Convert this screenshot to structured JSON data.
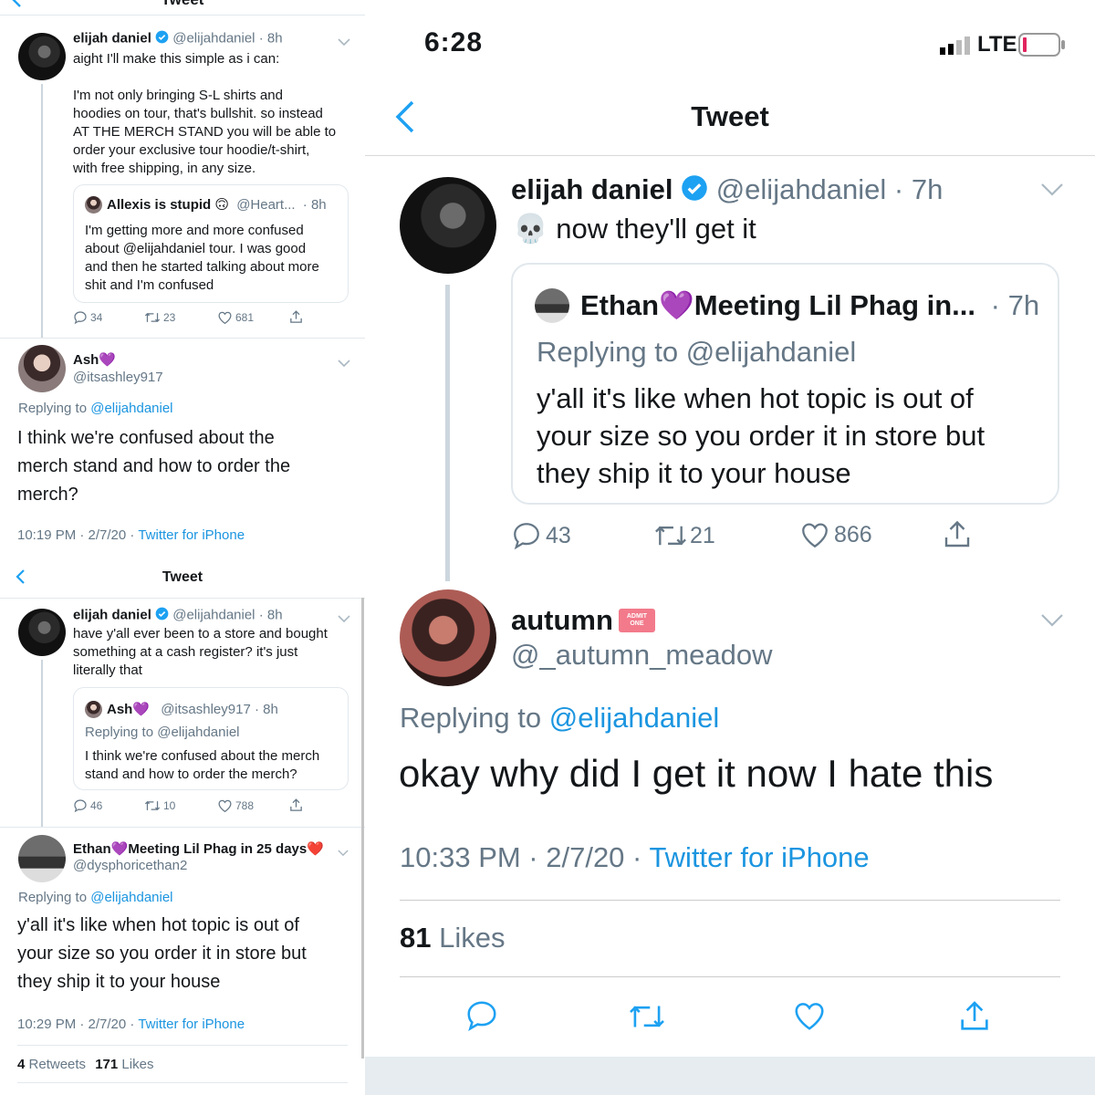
{
  "left_top": {
    "header_title": "Tweet",
    "tweet": {
      "name": "elijah daniel",
      "handle": "@elijahdaniel",
      "time": "· 8h",
      "line1": "aight I'll make this simple as i can:",
      "line2": "I'm not only bringing S-L shirts and",
      "line3": "hoodies on tour, that's bullshit. so instead",
      "line4": "AT THE MERCH STAND you will be able to",
      "line5": "order your exclusive tour hoodie/t-shirt,",
      "line6": "with free shipping, in any size.",
      "quote": {
        "name": "Allexis is stupid 🙃",
        "handle": "@Heart...",
        "time": "· 8h",
        "line1": "I'm getting more and more confused",
        "line2": "about @elijahdaniel tour. I was good",
        "line3": "and then he started talking about more",
        "line4": "shit and I'm confused"
      },
      "replies": "34",
      "retweets": "23",
      "likes": "681"
    },
    "reply": {
      "name": "Ash💜",
      "handle": "@itsashley917",
      "replying_prefix": "Replying to",
      "replying_to": "@elijahdaniel",
      "line1": "I think we're confused about the",
      "line2": "merch stand and how to order the",
      "line3": "merch?",
      "timestamp": "10:19 PM · 2/7/20 ·",
      "source": "Twitter for iPhone"
    }
  },
  "left_bottom": {
    "header_title": "Tweet",
    "tweet": {
      "name": "elijah daniel",
      "handle": "@elijahdaniel",
      "time": "· 8h",
      "line1": "have y'all ever been to a store and bought",
      "line2": "something at a cash register? it's just",
      "line3": "literally that",
      "quote": {
        "name": "Ash💜",
        "handle": "@itsashley917",
        "time": "· 8h",
        "replying": "Replying to @elijahdaniel",
        "line1": "I think we're confused about the merch",
        "line2": "stand and how to order the merch?"
      },
      "replies": "46",
      "retweets": "10",
      "likes": "788"
    },
    "reply": {
      "name": "Ethan💜Meeting Lil Phag in 25 days❤️",
      "handle": "@dysphoricethan2",
      "replying_prefix": "Replying to",
      "replying_to": "@elijahdaniel",
      "line1": "y'all it's like when hot topic is out of",
      "line2": "your size so you order it in store but",
      "line3": "they ship it to your house",
      "timestamp": "10:29 PM · 2/7/20 ·",
      "source": "Twitter for iPhone",
      "retweet_count": "4",
      "retweet_label": "Retweets",
      "like_count": "171",
      "like_label": "Likes"
    }
  },
  "right": {
    "status_time": "6:28",
    "network": "LTE",
    "header_title": "Tweet",
    "tweet": {
      "name": "elijah daniel",
      "handle": "@elijahdaniel",
      "time": "· 7h",
      "text": "💀  now they'll get it",
      "quote": {
        "name": "Ethan💜Meeting Lil Phag in...",
        "time": "· 7h",
        "replying": "Replying to @elijahdaniel",
        "line1": "y'all it's like when hot topic is out of",
        "line2": "your size so you order it in store but",
        "line3": "they ship it to your house"
      },
      "replies": "43",
      "retweets": "21",
      "likes": "866"
    },
    "reply": {
      "name": "autumn",
      "badge_line1": "ADMIT",
      "badge_line2": "ONE",
      "handle": "@_autumn_meadow",
      "replying_prefix": "Replying to",
      "replying_to": "@elijahdaniel",
      "text": "okay why did I get it now I hate this",
      "timestamp": "10:33 PM · 2/7/20 ·",
      "source": "Twitter for iPhone",
      "like_count": "81",
      "like_label": "Likes"
    }
  },
  "colors": {
    "link": "#1b95e0",
    "secondary": "#657786",
    "text": "#14171a",
    "border": "#e1e8ed",
    "verified": "#1da1f2",
    "battery_low": "#e0245e"
  }
}
